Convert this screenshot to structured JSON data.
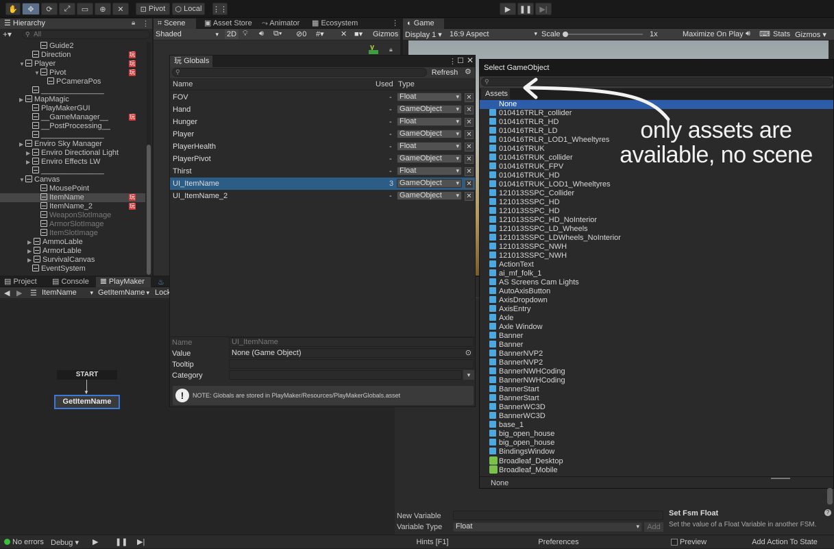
{
  "toolbar": {
    "pivot": "Pivot",
    "local": "Local"
  },
  "hierarchy": {
    "tab": "Hierarchy",
    "search_placeholder": "All",
    "items": [
      {
        "label": "Guide2",
        "dim": false
      },
      {
        "label": "Direction",
        "dim": false
      },
      {
        "label": "Player",
        "dim": false
      },
      {
        "label": "Pivot",
        "dim": false
      },
      {
        "label": "PCameraPos",
        "dim": false
      },
      {
        "label": "_______________",
        "dim": false
      },
      {
        "label": "MapMagic",
        "dim": false
      },
      {
        "label": "PlayMakerGUI",
        "dim": false
      },
      {
        "label": "__GameManager__",
        "dim": false
      },
      {
        "label": "__PostProcessing__",
        "dim": false
      },
      {
        "label": "_______________",
        "dim": false
      },
      {
        "label": "Enviro Sky Manager",
        "dim": false
      },
      {
        "label": "Enviro Directional Light",
        "dim": false
      },
      {
        "label": "Enviro Effects LW",
        "dim": false
      },
      {
        "label": "_______________",
        "dim": false
      },
      {
        "label": "Canvas",
        "dim": false
      },
      {
        "label": "MousePoint",
        "dim": false
      },
      {
        "label": "ItemName",
        "dim": false
      },
      {
        "label": "ItemName_2",
        "dim": false
      },
      {
        "label": "WeaponSlotImage",
        "dim": true
      },
      {
        "label": "ArmorSlotImage",
        "dim": true
      },
      {
        "label": "ItemSlotImage",
        "dim": true
      },
      {
        "label": "AmmoLable",
        "dim": false
      },
      {
        "label": "ArmorLable",
        "dim": false
      },
      {
        "label": "SurvivalCanvas",
        "dim": false
      },
      {
        "label": "EventSystem",
        "dim": false
      }
    ]
  },
  "scene": {
    "tabs": [
      "Scene",
      "Asset Store",
      "Animator",
      "Ecosystem"
    ],
    "shading": "Shaded",
    "mode_2d": "2D",
    "gizmos": "Gizmos",
    "hidden_count": "0",
    "axis_y": "y"
  },
  "game": {
    "tab": "Game",
    "display": "Display 1",
    "aspect": "16:9 Aspect",
    "scale_label": "Scale",
    "scale_value": "1x",
    "maximize": "Maximize On Play",
    "stats": "Stats",
    "gizmos": "Gizmos"
  },
  "globals": {
    "title": "Globals",
    "refresh": "Refresh",
    "columns": {
      "name": "Name",
      "used": "Used",
      "type": "Type"
    },
    "rows": [
      {
        "name": "FOV",
        "used": "-",
        "type": "Float"
      },
      {
        "name": "Hand",
        "used": "-",
        "type": "GameObject"
      },
      {
        "name": "Hunger",
        "used": "-",
        "type": "Float"
      },
      {
        "name": "Player",
        "used": "-",
        "type": "GameObject"
      },
      {
        "name": "PlayerHealth",
        "used": "-",
        "type": "Float"
      },
      {
        "name": "PlayerPivot",
        "used": "-",
        "type": "GameObject"
      },
      {
        "name": "Thirst",
        "used": "-",
        "type": "Float"
      },
      {
        "name": "UI_ItemName",
        "used": "3",
        "type": "GameObject"
      },
      {
        "name": "UI_ItemName_2",
        "used": "-",
        "type": "GameObject"
      }
    ],
    "detail": {
      "name_label": "Name",
      "name_value": "UI_ItemName",
      "value_label": "Value",
      "value": "None (Game Object)",
      "tooltip_label": "Tooltip",
      "category_label": "Category"
    },
    "note": "NOTE: Globals are stored in PlayMaker/Resources/PlayMakerGlobals.asset"
  },
  "bottom_tabs": {
    "project": "Project",
    "console": "Console",
    "playmaker": "PlayMaker"
  },
  "playmaker": {
    "object": "ItemName",
    "fsm": "GetItemName",
    "lock": "Lock",
    "start": "START",
    "state": "GetItemName"
  },
  "select": {
    "title": "Select GameObject",
    "tab": "Assets",
    "none": "None",
    "annotation_line1": "only assets are",
    "annotation_line2": "available, no scene",
    "items": [
      {
        "label": "010416TRLR_collider",
        "icon": "prefab"
      },
      {
        "label": "010416TRLR_HD",
        "icon": "prefab"
      },
      {
        "label": "010416TRLR_LD",
        "icon": "prefab"
      },
      {
        "label": "010416TRLR_LOD1_Wheeltyres",
        "icon": "prefab"
      },
      {
        "label": "010416TRUK",
        "icon": "prefab"
      },
      {
        "label": "010416TRUK_collider",
        "icon": "prefab"
      },
      {
        "label": "010416TRUK_FPV",
        "icon": "prefab"
      },
      {
        "label": "010416TRUK_HD",
        "icon": "prefab"
      },
      {
        "label": "010416TRUK_LOD1_Wheeltyres",
        "icon": "prefab"
      },
      {
        "label": "121013SSPC_Collider",
        "icon": "prefab"
      },
      {
        "label": "121013SSPC_HD",
        "icon": "prefab"
      },
      {
        "label": "121013SSPC_HD",
        "icon": "prefab"
      },
      {
        "label": "121013SSPC_HD_NoInterior",
        "icon": "prefab"
      },
      {
        "label": "121013SSPC_LD_Wheels",
        "icon": "prefab"
      },
      {
        "label": "121013SSPC_LDWheels_NoInterior",
        "icon": "prefab"
      },
      {
        "label": "121013SSPC_NWH",
        "icon": "prefab"
      },
      {
        "label": "121013SSPC_NWH",
        "icon": "prefab"
      },
      {
        "label": "ActionText",
        "icon": "prefab"
      },
      {
        "label": "ai_mf_folk_1",
        "icon": "prefab"
      },
      {
        "label": "AS Screens Cam Lights",
        "icon": "prefab"
      },
      {
        "label": "AutoAxisButton",
        "icon": "prefab"
      },
      {
        "label": "AxisDropdown",
        "icon": "prefab"
      },
      {
        "label": "AxisEntry",
        "icon": "prefab"
      },
      {
        "label": "Axle",
        "icon": "prefab"
      },
      {
        "label": "Axle Window",
        "icon": "prefab"
      },
      {
        "label": "Banner",
        "icon": "prefab"
      },
      {
        "label": "Banner",
        "icon": "prefab"
      },
      {
        "label": "BannerNVP2",
        "icon": "prefab"
      },
      {
        "label": "BannerNVP2",
        "icon": "prefab"
      },
      {
        "label": "BannerNWHCoding",
        "icon": "prefab"
      },
      {
        "label": "BannerNWHCoding",
        "icon": "prefab"
      },
      {
        "label": "BannerStart",
        "icon": "prefab"
      },
      {
        "label": "BannerStart",
        "icon": "prefab"
      },
      {
        "label": "BannerWC3D",
        "icon": "prefab"
      },
      {
        "label": "BannerWC3D",
        "icon": "prefab"
      },
      {
        "label": "base_1",
        "icon": "prefab"
      },
      {
        "label": "big_open_house",
        "icon": "prefab"
      },
      {
        "label": "big_open_house",
        "icon": "prefab"
      },
      {
        "label": "BindingsWindow",
        "icon": "prefab"
      },
      {
        "label": "Broadleaf_Desktop",
        "icon": "leaf"
      },
      {
        "label": "Broadleaf_Mobile",
        "icon": "leaf"
      }
    ],
    "footer": "None"
  },
  "vars": {
    "new_variable": "New Variable",
    "variable_type": "Variable Type",
    "type_value": "Float",
    "add": "Add",
    "hints": "Hints [F1]",
    "preferences": "Preferences"
  },
  "action": {
    "title": "Set Fsm Float",
    "desc": "Set the value of a Float Variable in another FSM.",
    "preview": "Preview",
    "add_action": "Add Action To State"
  },
  "status": {
    "errors": "No errors",
    "debug": "Debug"
  }
}
